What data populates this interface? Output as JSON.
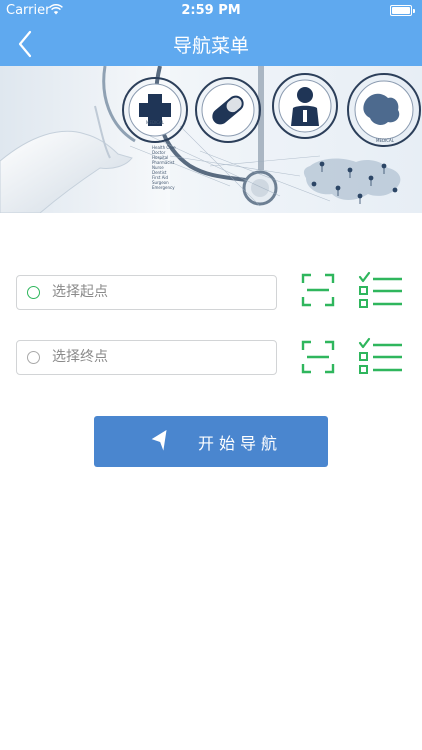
{
  "status_bar": {
    "carrier": "Carrier",
    "time": "2:59 PM"
  },
  "nav": {
    "title": "导航菜单",
    "back_icon": "chevron-left-icon"
  },
  "banner": {
    "image": "medical-technology-banner",
    "list_text": [
      "Health Care",
      "Doctor",
      "Hospital",
      "Pharmacist",
      "Nurse",
      "Dentist",
      "First Aid",
      "Surgeon",
      "Emergency"
    ],
    "circle_labels": [
      "MEDICAL",
      "MEDICAL"
    ]
  },
  "route": {
    "start": {
      "placeholder": "选择起点",
      "value": "",
      "marker": "green-circle"
    },
    "end": {
      "placeholder": "选择终点",
      "value": "",
      "marker": "gray-circle"
    },
    "scan_icon": "scan-icon",
    "list_icon": "checklist-icon"
  },
  "start_button": {
    "label": "开始导航",
    "icon": "navigation-arrow-icon"
  },
  "colors": {
    "primary": "#5fa9ef",
    "button": "#4a86cf",
    "accent_green": "#2fb65d",
    "border": "#d2d4d6"
  }
}
